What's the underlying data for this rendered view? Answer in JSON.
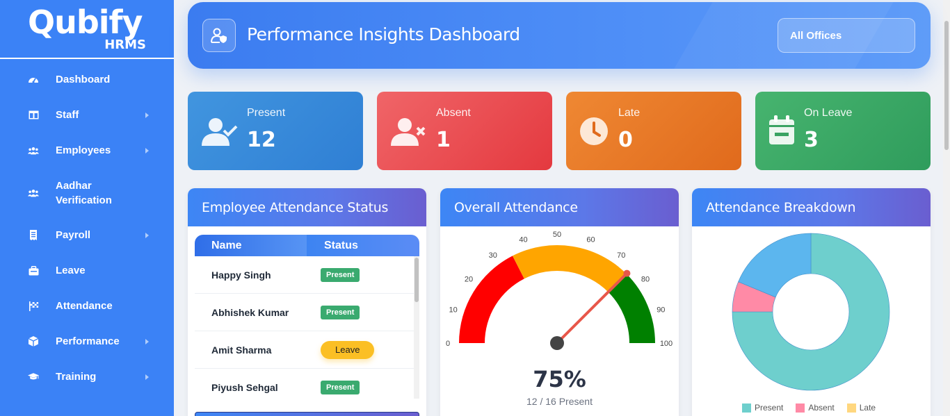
{
  "brand": {
    "name": "Qubify",
    "sub": "HRMS"
  },
  "sidebar": {
    "items": [
      {
        "label": "Dashboard",
        "icon": "gauge-icon",
        "arrow": false
      },
      {
        "label": "Staff",
        "icon": "columns-icon",
        "arrow": true
      },
      {
        "label": "Employees",
        "icon": "users-icon",
        "arrow": true
      },
      {
        "label": "Aadhar Verification",
        "icon": "users-icon",
        "arrow": false
      },
      {
        "label": "Payroll",
        "icon": "receipt-icon",
        "arrow": true
      },
      {
        "label": "Leave",
        "icon": "briefcase-icon",
        "arrow": false
      },
      {
        "label": "Attendance",
        "icon": "flag-icon",
        "arrow": false
      },
      {
        "label": "Performance",
        "icon": "cube-icon",
        "arrow": true
      },
      {
        "label": "Training",
        "icon": "graduation-cap-icon",
        "arrow": true
      }
    ]
  },
  "header": {
    "title": "Performance Insights Dashboard",
    "office_filter": "All Offices"
  },
  "stats": {
    "present": {
      "label": "Present",
      "value": "12"
    },
    "absent": {
      "label": "Absent",
      "value": "1"
    },
    "late": {
      "label": "Late",
      "value": "0"
    },
    "leave": {
      "label": "On Leave",
      "value": "3"
    }
  },
  "attendance_status": {
    "title": "Employee Attendance Status",
    "columns": [
      "Name",
      "Status"
    ],
    "rows": [
      {
        "name": "Happy Singh",
        "status": "Present"
      },
      {
        "name": "Abhishek Kumar",
        "status": "Present"
      },
      {
        "name": "Amit Sharma",
        "status": "Leave"
      },
      {
        "name": "Piyush Sehgal",
        "status": "Present"
      }
    ]
  },
  "overall": {
    "title": "Overall Attendance",
    "percent_label": "75%",
    "sub_label": "12 / 16 Present",
    "gauge": {
      "min": 0,
      "max": 100,
      "value": 75,
      "ticks": [
        0,
        10,
        20,
        30,
        40,
        50,
        60,
        70,
        80,
        90,
        100
      ],
      "bands": [
        {
          "from": 0,
          "to": 35,
          "color": "#ff0000"
        },
        {
          "from": 35,
          "to": 75,
          "color": "#ffa500"
        },
        {
          "from": 75,
          "to": 100,
          "color": "#008000"
        }
      ]
    }
  },
  "breakdown": {
    "title": "Attendance Breakdown"
  },
  "chart_data": {
    "type": "pie",
    "categories": [
      "Present",
      "Absent",
      "Late",
      "On Leave"
    ],
    "values": [
      12,
      1,
      0,
      3
    ],
    "legend": [
      "Present",
      "Absent",
      "Late"
    ],
    "colors": [
      "#6ecfcd",
      "#ff8aa6",
      "#ffd77f",
      "#5cb6ee"
    ],
    "donut": true
  }
}
